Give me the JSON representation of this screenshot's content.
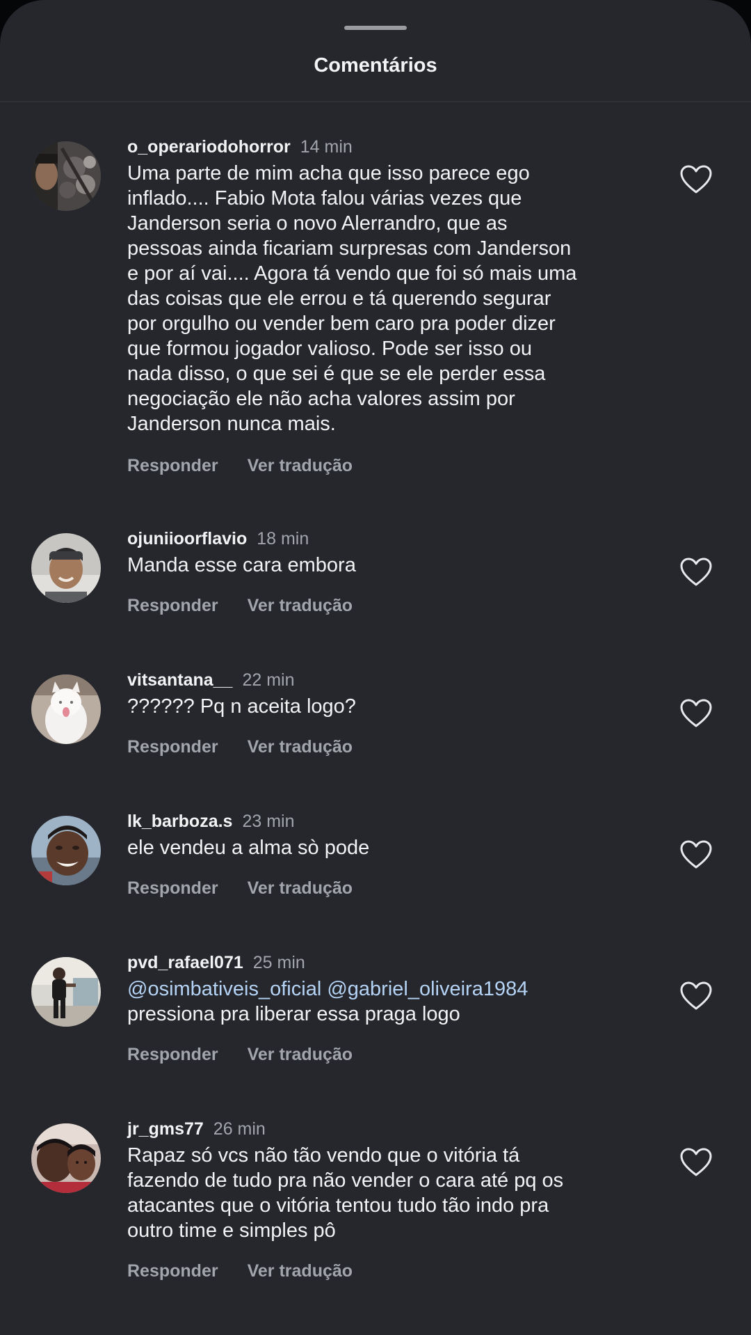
{
  "sheet": {
    "title": "Comentários"
  },
  "labels": {
    "reply": "Responder",
    "translate": "Ver tradução"
  },
  "comments": [
    {
      "username": "o_operariodohorror",
      "time": "14 min",
      "lines": [
        "Uma parte de mim acha que isso parece ego",
        "inflado.... Fabio Mota falou várias vezes que",
        "Janderson seria o novo Alerrandro, que as",
        "pessoas ainda ficariam surpresas com Janderson",
        "e por aí vai.... Agora tá vendo que foi só mais uma",
        "das coisas que ele errou e tá querendo segurar",
        "por orgulho ou vender bem caro pra poder dizer",
        "que formou jogador valioso. Pode ser isso ou",
        "nada disso, o que sei é que se ele perder essa",
        "negociação ele não acha valores assim por",
        "Janderson nunca mais."
      ]
    },
    {
      "username": "ojuniioorflavio",
      "time": "18 min",
      "lines": [
        "Manda esse cara embora"
      ]
    },
    {
      "username": "vitsantana__",
      "time": "22 min",
      "lines": [
        "?????? Pq n aceita logo?"
      ]
    },
    {
      "username": "lk_barboza.s",
      "time": "23 min",
      "lines": [
        "ele vendeu a alma sò pode"
      ]
    },
    {
      "username": "pvd_rafael071",
      "time": "25 min",
      "mentions": [
        "@osimbativeis_oficial",
        "@gabriel_oliveira1984"
      ],
      "lines": [
        "pressiona pra liberar essa praga logo"
      ]
    },
    {
      "username": "jr_gms77",
      "time": "26 min",
      "lines": [
        "Rapaz só vcs não tão vendo que o vitória tá",
        "fazendo de tudo pra não vender o cara até pq os",
        "atacantes que o vitória tentou tudo tão indo pra",
        "outro time e simples pô"
      ]
    }
  ],
  "colors": {
    "sheet_background": "#25272c",
    "primary_text": "#f2f3f5",
    "secondary_text": "#a2a5ab",
    "mention": "#b5d3f5"
  },
  "icons": {
    "like": "heart-outline-icon"
  }
}
